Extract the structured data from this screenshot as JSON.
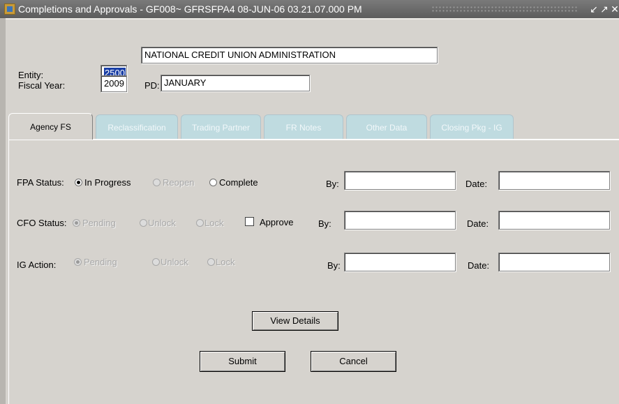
{
  "window": {
    "title": "Completions and Approvals - GF008~ GFRSFPA4  08-JUN-06 03.21.07.000 PM",
    "controls": [
      "↙",
      "↗",
      "✕"
    ]
  },
  "header": {
    "entity_label": "Entity:",
    "entity_code": "2500",
    "entity_name": "NATIONAL CREDIT UNION ADMINISTRATION",
    "fiscal_year_label": "Fiscal Year:",
    "fiscal_year": "2009",
    "pd_label": "PD:",
    "pd_value": "JANUARY"
  },
  "tabs": [
    {
      "label": "Agency FS",
      "active": true
    },
    {
      "label": "Reclassification",
      "active": false
    },
    {
      "label": "Trading Partner",
      "active": false
    },
    {
      "label": "FR Notes",
      "active": false
    },
    {
      "label": "Other Data",
      "active": false
    },
    {
      "label": "Closing Pkg - IG",
      "active": false
    }
  ],
  "fpa": {
    "label": "FPA Status:",
    "options": [
      {
        "label": "In Progress",
        "selected": true,
        "enabled": true
      },
      {
        "label": "Reopen",
        "selected": false,
        "enabled": false
      },
      {
        "label": "Complete",
        "selected": false,
        "enabled": true
      }
    ],
    "by_label": "By:",
    "by_value": "",
    "date_label": "Date:",
    "date_value": ""
  },
  "cfo": {
    "label": "CFO Status:",
    "options": [
      {
        "label": "Pending",
        "selected": true,
        "enabled": false
      },
      {
        "label": "Unlock",
        "selected": false,
        "enabled": false
      },
      {
        "label": "Lock",
        "selected": false,
        "enabled": false
      }
    ],
    "approve_label": "Approve",
    "approve_checked": false,
    "by_label": "By:",
    "by_value": "",
    "date_label": "Date:",
    "date_value": ""
  },
  "ig": {
    "label": "IG Action:",
    "options": [
      {
        "label": "Pending",
        "selected": true,
        "enabled": false
      },
      {
        "label": "Unlock",
        "selected": false,
        "enabled": false
      },
      {
        "label": "Lock",
        "selected": false,
        "enabled": false
      }
    ],
    "by_label": "By:",
    "by_value": "",
    "date_label": "Date:",
    "date_value": ""
  },
  "buttons": {
    "view_details": "View Details",
    "submit": "Submit",
    "cancel": "Cancel"
  }
}
